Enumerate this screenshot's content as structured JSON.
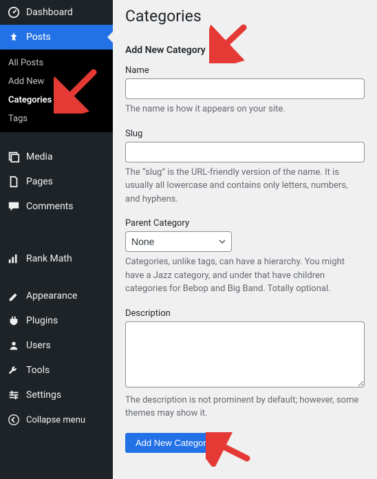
{
  "sidebar": {
    "dashboard": "Dashboard",
    "posts": "Posts",
    "posts_submenu": {
      "all_posts": "All Posts",
      "add_new": "Add New",
      "categories": "Categories",
      "tags": "Tags"
    },
    "media": "Media",
    "pages": "Pages",
    "comments": "Comments",
    "rank_math": "Rank Math",
    "appearance": "Appearance",
    "plugins": "Plugins",
    "users": "Users",
    "tools": "Tools",
    "settings": "Settings",
    "collapse": "Collapse menu"
  },
  "page": {
    "title": "Categories",
    "form_title": "Add New Category",
    "name_label": "Name",
    "name_value": "",
    "name_help": "The name is how it appears on your site.",
    "slug_label": "Slug",
    "slug_value": "",
    "slug_help": "The “slug” is the URL-friendly version of the name. It is usually all lowercase and contains only letters, numbers, and hyphens.",
    "parent_label": "Parent Category",
    "parent_selected": "None",
    "parent_help": "Categories, unlike tags, can have a hierarchy. You might have a Jazz category, and under that have children categories for Bebop and Big Band. Totally optional.",
    "desc_label": "Description",
    "desc_value": "",
    "desc_help": "The description is not prominent by default; however, some themes may show it.",
    "submit_label": "Add New Category"
  },
  "colors": {
    "accent": "#2271e6",
    "arrow": "#e53935"
  }
}
